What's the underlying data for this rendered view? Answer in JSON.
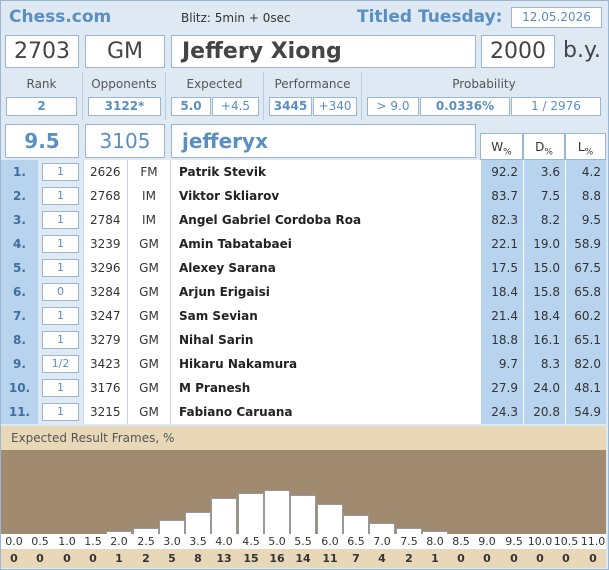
{
  "header": {
    "brand": "Chess.com",
    "blitz": "Blitz:  5min + 0sec",
    "event": "Titled Tuesday:",
    "date": "12.05.2026"
  },
  "player": {
    "rating": "2703",
    "title": "GM",
    "name": "Jeffery Xiong",
    "birth_year": "2000",
    "birth_suffix": "b.y."
  },
  "stats": {
    "rank_label": "Rank",
    "rank": "2",
    "opponents_label": "Opponents",
    "opponents": "3122*",
    "expected_label": "Expected",
    "expected": "5.0",
    "expected_delta": "+4.5",
    "performance_label": "Performance",
    "performance": "3445",
    "performance_delta": "+340",
    "probability_label": "Probability",
    "prob_threshold": "> 9.0",
    "prob_value": "0.0336%",
    "prob_ratio": "1 / 2976"
  },
  "score": {
    "points": "9.5",
    "rating": "3105",
    "username": "jefferyx"
  },
  "wdl_headers": {
    "w": "W",
    "d": "D",
    "l": "L",
    "unit": "%"
  },
  "games": [
    {
      "round": "1.",
      "result": "1",
      "rating": "2626",
      "title": "FM",
      "name": "Patrik Stevik",
      "w": "92.2",
      "d": "3.6",
      "l": "4.2"
    },
    {
      "round": "2.",
      "result": "1",
      "rating": "2768",
      "title": "IM",
      "name": "Viktor Skliarov",
      "w": "83.7",
      "d": "7.5",
      "l": "8.8"
    },
    {
      "round": "3.",
      "result": "1",
      "rating": "2784",
      "title": "IM",
      "name": "Angel Gabriel Cordoba Roa",
      "w": "82.3",
      "d": "8.2",
      "l": "9.5"
    },
    {
      "round": "4.",
      "result": "1",
      "rating": "3239",
      "title": "GM",
      "name": "Amin Tabatabaei",
      "w": "22.1",
      "d": "19.0",
      "l": "58.9"
    },
    {
      "round": "5.",
      "result": "1",
      "rating": "3296",
      "title": "GM",
      "name": "Alexey Sarana",
      "w": "17.5",
      "d": "15.0",
      "l": "67.5"
    },
    {
      "round": "6.",
      "result": "0",
      "rating": "3284",
      "title": "GM",
      "name": "Arjun Erigaisi",
      "w": "18.4",
      "d": "15.8",
      "l": "65.8"
    },
    {
      "round": "7.",
      "result": "1",
      "rating": "3247",
      "title": "GM",
      "name": "Sam Sevian",
      "w": "21.4",
      "d": "18.4",
      "l": "60.2"
    },
    {
      "round": "8.",
      "result": "1",
      "rating": "3279",
      "title": "GM",
      "name": "Nihal Sarin",
      "w": "18.8",
      "d": "16.1",
      "l": "65.1"
    },
    {
      "round": "9.",
      "result": "1/2",
      "rating": "3423",
      "title": "GM",
      "name": "Hikaru Nakamura",
      "w": "9.7",
      "d": "8.3",
      "l": "82.0"
    },
    {
      "round": "10.",
      "result": "1",
      "rating": "3176",
      "title": "GM",
      "name": "M Pranesh",
      "w": "27.9",
      "d": "24.0",
      "l": "48.1"
    },
    {
      "round": "11.",
      "result": "1",
      "rating": "3215",
      "title": "GM",
      "name": "Fabiano Caruana",
      "w": "24.3",
      "d": "20.8",
      "l": "54.9"
    }
  ],
  "frames": {
    "title": "Expected Result Frames, %",
    "labels": [
      "0.0",
      "0.5",
      "1.0",
      "1.5",
      "2.0",
      "2.5",
      "3.0",
      "3.5",
      "4.0",
      "4.5",
      "5.0",
      "5.5",
      "6.0",
      "6.5",
      "7.0",
      "7.5",
      "8.0",
      "8.5",
      "9.0",
      "9.5",
      "10.0",
      "10.5",
      "11.0"
    ],
    "counts": [
      "0",
      "0",
      "0",
      "0",
      "1",
      "2",
      "5",
      "8",
      "13",
      "15",
      "16",
      "14",
      "11",
      "7",
      "4",
      "2",
      "1",
      "0",
      "0",
      "0",
      "0",
      "0",
      "0"
    ]
  },
  "chart_data": {
    "type": "bar",
    "title": "Expected Result Frames, %",
    "categories": [
      "0.0",
      "0.5",
      "1.0",
      "1.5",
      "2.0",
      "2.5",
      "3.0",
      "3.5",
      "4.0",
      "4.5",
      "5.0",
      "5.5",
      "6.0",
      "6.5",
      "7.0",
      "7.5",
      "8.0",
      "8.5",
      "9.0",
      "9.5",
      "10.0",
      "10.5",
      "11.0"
    ],
    "values": [
      0,
      0,
      0,
      0,
      1,
      2,
      5,
      8,
      13,
      15,
      16,
      14,
      11,
      7,
      4,
      2,
      1,
      0,
      0,
      0,
      0,
      0,
      0
    ]
  }
}
